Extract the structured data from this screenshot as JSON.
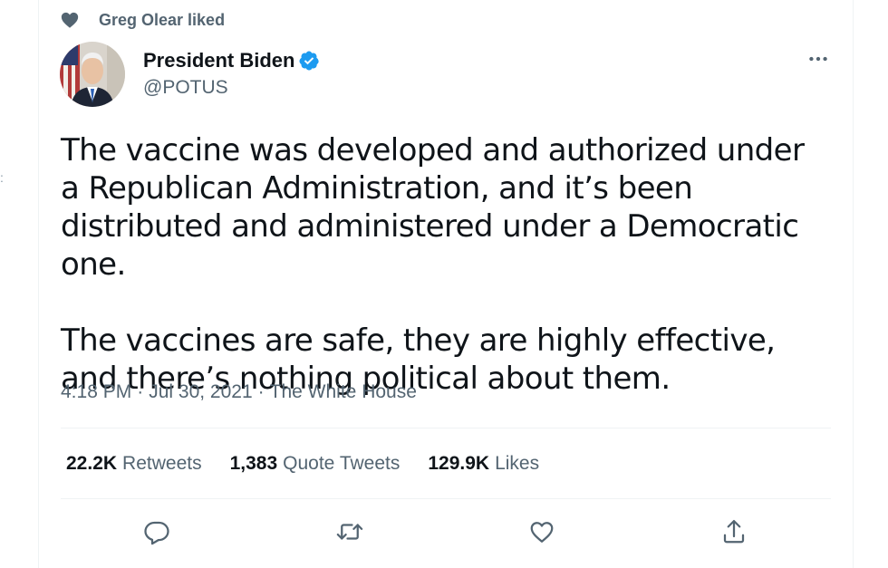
{
  "social_context": {
    "text": "Greg Olear liked",
    "icon": "heart-filled-icon"
  },
  "author": {
    "display_name": "President Biden",
    "handle": "@POTUS",
    "verified": true,
    "verified_color": "#1d9bf0"
  },
  "tweet": {
    "paragraphs": [
      "The vaccine was developed and authorized under a Republican Administration, and it’s been distributed and administered under a Democratic one.",
      "The vaccines are safe, they are highly effective, and there’s nothing political about them."
    ],
    "time": "4:18 PM",
    "date": "Jul 30, 2021",
    "source": "The White House",
    "separator": "·"
  },
  "stats": {
    "retweets_count": "22.2K",
    "retweets_label": "Retweets",
    "quotes_count": "1,383",
    "quotes_label": "Quote Tweets",
    "likes_count": "129.9K",
    "likes_label": "Likes"
  },
  "actions": [
    {
      "name": "reply",
      "icon": "reply-icon"
    },
    {
      "name": "retweet",
      "icon": "retweet-icon"
    },
    {
      "name": "like",
      "icon": "heart-outline-icon"
    },
    {
      "name": "share",
      "icon": "share-icon"
    }
  ],
  "colors": {
    "text_primary": "#0f1419",
    "text_secondary": "#536471",
    "divider": "#eff3f4",
    "brand_blue": "#1d9bf0"
  }
}
